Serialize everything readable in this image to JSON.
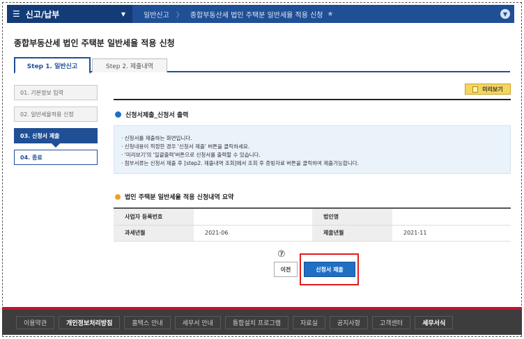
{
  "topbar": {
    "menu_label": "신고/납부",
    "crumbs": [
      "일반신고",
      "종합부동산세 법인 주택분 일반세율 적용 신청"
    ]
  },
  "page_title": "종합부동산세 법인 주택분 일반세율 적용 신청",
  "tabs": [
    "Step 1. 일반신고",
    "Step 2. 제출내역"
  ],
  "steps": [
    "01. 기본정보 입력",
    "02. 일반세율적용 신청",
    "03. 신청서 제출",
    "04. 종료"
  ],
  "preview_label": "미리보기",
  "section1_title": "신청서제출_신청서 출력",
  "info_lines": [
    "신청서를 제출하는 화면입니다.",
    "신청내용이 적정한 경우 '신청서 제출' 버튼을 클릭하세요.",
    "'미리보기'의 '일괄출력'버튼으로 신청서를 출력할 수 있습니다.",
    "첨부서류는 신청서 제출 후 [step2. 제출내역 조회]에서 조회 후 증빙자료 버튼을 클릭하여 제출가능합니다."
  ],
  "section2_title": "법인 주택분 일반세율 적용 신청내역 요약",
  "summary": {
    "row1": {
      "h1": "사업자 등록번호",
      "v1": "",
      "h2": "법인명",
      "v2": ""
    },
    "row2": {
      "h1": "과세년월",
      "v1": "2021-06",
      "h2": "제출년월",
      "v2": "2021-11"
    }
  },
  "step_marker": "⑦",
  "buttons": {
    "prev": "이전",
    "submit": "신청서 제출"
  },
  "footer_links": [
    "이용약관",
    "개인정보처리방침",
    "홈택스 안내",
    "세무서 안내",
    "통합설치 프로그램",
    "자료실",
    "공지사항",
    "고객센터",
    "세무서식"
  ]
}
